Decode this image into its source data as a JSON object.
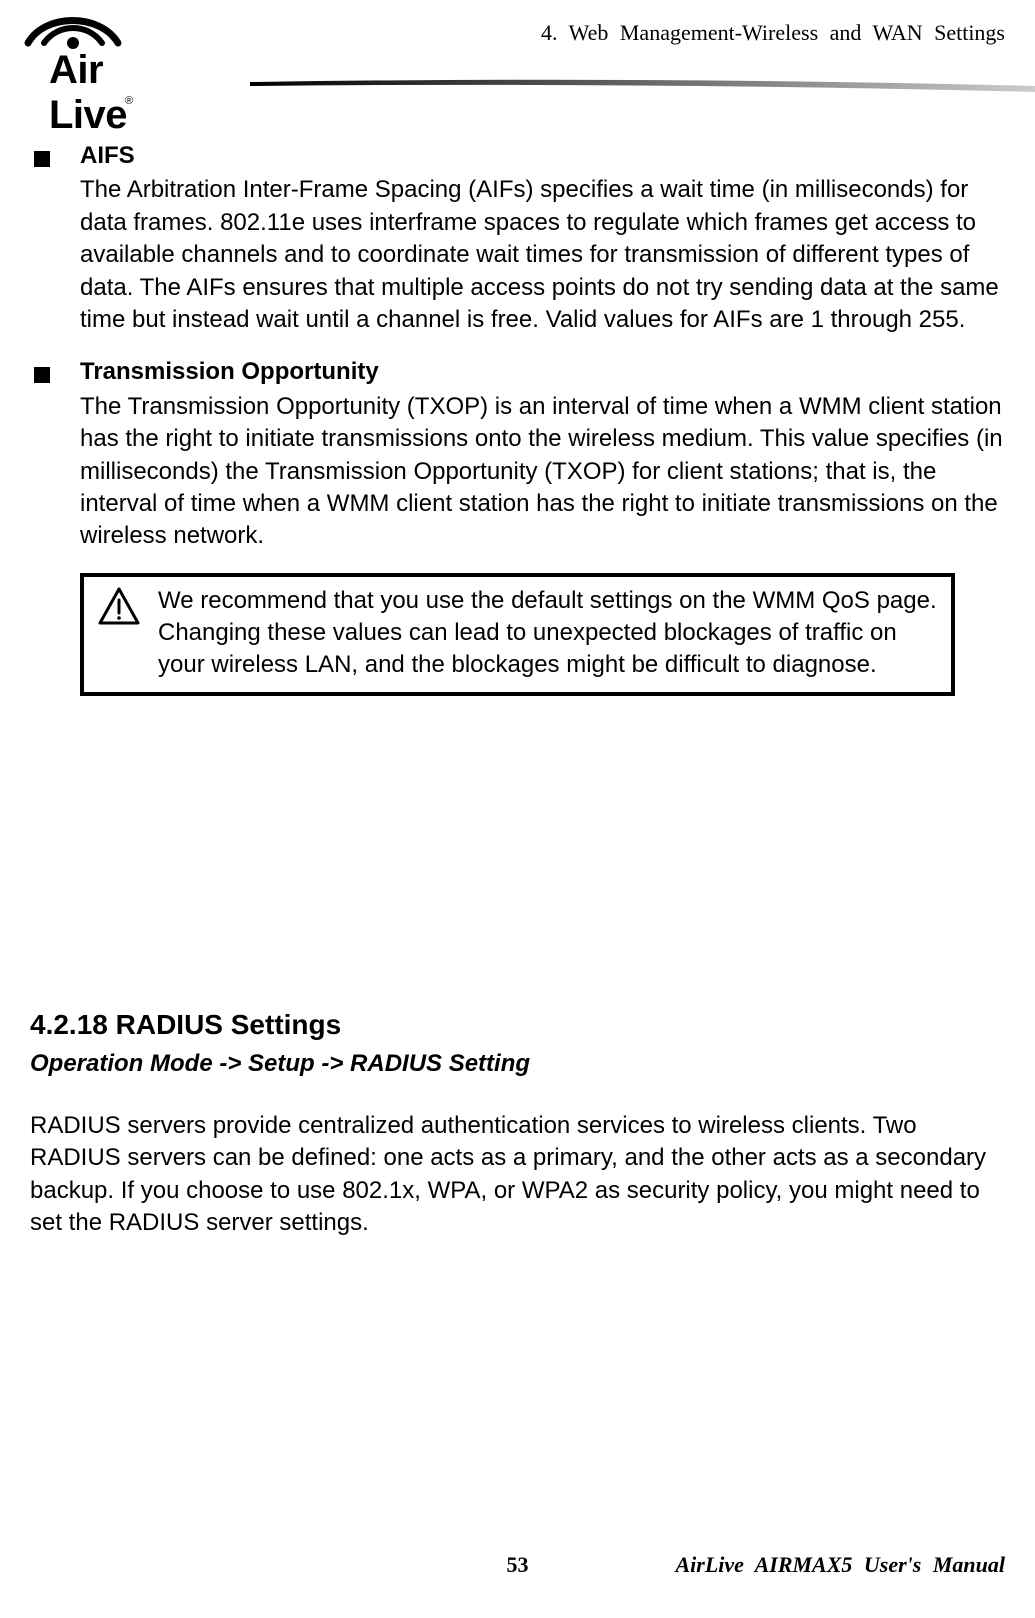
{
  "header": {
    "chapter": "4. Web Management-Wireless and WAN Settings",
    "logo_text": "Air Live"
  },
  "bullets": [
    {
      "title": "AIFS",
      "body": "The Arbitration Inter-Frame Spacing (AIFs) specifies a wait time (in milliseconds) for data frames. 802.11e uses interframe spaces to regulate which frames get access to available channels and to coordinate wait times for transmission of different types of data. The AIFs ensures that multiple access points do not try sending data at the same time but instead wait until a channel is free.   Valid values for AIFs are 1 through 255."
    },
    {
      "title": "Transmission Opportunity",
      "body": "The Transmission Opportunity (TXOP) is an interval of time when a WMM client station has the right to initiate transmissions onto the wireless medium.   This value specifies (in milliseconds) the Transmission Opportunity (TXOP) for client stations; that is, the interval of time when a WMM client station has the right to initiate transmissions on the wireless network."
    }
  ],
  "note": "We recommend that you use the default settings on the WMM QoS page. Changing these values can lead to unexpected blockages of traffic on your wireless LAN, and the blockages might be difficult to diagnose.",
  "section": {
    "heading": "4.2.18 RADIUS Settings",
    "breadcrumb": "Operation Mode -> Setup -> RADIUS Setting",
    "paragraph": "RADIUS servers provide centralized authentication services to wireless clients. Two RADIUS servers can be defined: one acts as a primary, and the other acts as a secondary backup. If you choose to use 802.1x, WPA, or WPA2 as security policy, you might need to set the RADIUS server settings."
  },
  "footer": {
    "page": "53",
    "manual": "AirLive AIRMAX5 User's Manual"
  }
}
